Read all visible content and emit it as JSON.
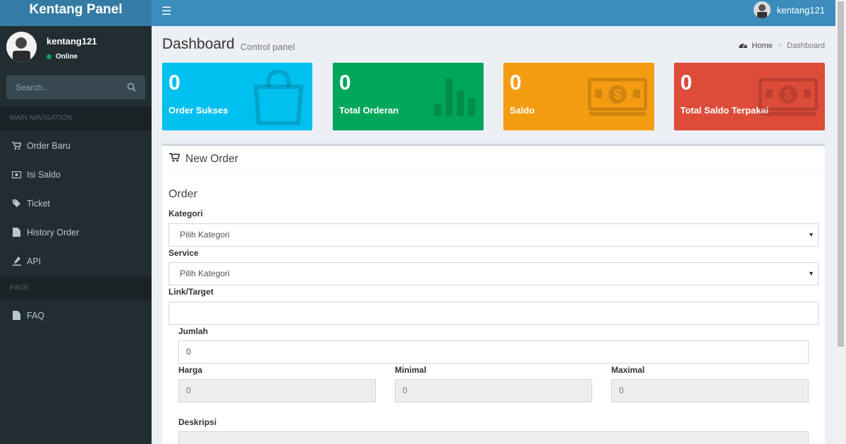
{
  "header": {
    "logo": "Kentang Panel",
    "username": "kentang121"
  },
  "sidebar": {
    "user": {
      "name": "kentang121",
      "status": "Online"
    },
    "search_placeholder": "Search...",
    "sections": [
      {
        "title": "MAIN NAVIGATION"
      },
      {
        "title": "PAGE"
      }
    ],
    "items": [
      {
        "label": "Order Baru",
        "icon": "cart-icon"
      },
      {
        "label": "Isi Saldo",
        "icon": "money-icon"
      },
      {
        "label": "Ticket",
        "icon": "tag-icon"
      },
      {
        "label": "History Order",
        "icon": "file-icon"
      },
      {
        "label": "API",
        "icon": "pen-icon"
      },
      {
        "label": "FAQ",
        "icon": "file-icon"
      }
    ]
  },
  "page": {
    "title": "Dashboard",
    "subtitle": "Control panel",
    "breadcrumb": {
      "home": "Home",
      "current": "Dashboard"
    }
  },
  "stats": [
    {
      "value": "0",
      "label": "Order Sukses",
      "color": "#00c0ef",
      "icon": "shopping-bag-icon"
    },
    {
      "value": "0",
      "label": "Total Orderan",
      "color": "#00a65a",
      "icon": "bar-chart-icon"
    },
    {
      "value": "0",
      "label": "Saldo",
      "color": "#f39c12",
      "icon": "money-bill-icon"
    },
    {
      "value": "0",
      "label": "Total Saldo Terpakai",
      "color": "#dd4b39",
      "icon": "money-bill-icon"
    }
  ],
  "order_form": {
    "card_title": "New Order",
    "section_title": "Order",
    "kategori_label": "Kategori",
    "kategori_value": "Pilih Kategori",
    "service_label": "Service",
    "service_value": "Pilih Kategori",
    "link_label": "Link/Target",
    "link_value": "",
    "jumlah_label": "Jumlah",
    "jumlah_value": "0",
    "harga_label": "Harga",
    "harga_value": "0",
    "minimal_label": "Minimal",
    "minimal_value": "0",
    "maximal_label": "Maximal",
    "maximal_value": "0",
    "deskripsi_label": "Deskripsi"
  }
}
